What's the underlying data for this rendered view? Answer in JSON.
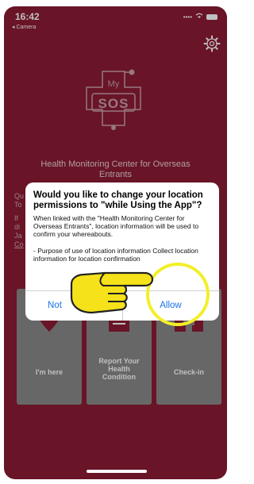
{
  "status_bar": {
    "time": "16:42",
    "back_app": "◂ Camera",
    "signal": "....",
    "wifi": "wifi"
  },
  "logo": {
    "small": "My",
    "large": "SOS"
  },
  "headline": "Health Monitoring Center for Overseas Entrants",
  "background_text": {
    "line_a1": "Qu",
    "line_a2": "To",
    "line_b1": "If",
    "line_b2": "di",
    "line_b3": "Ja",
    "line_b4": "Co"
  },
  "tiles": [
    {
      "label": "I'm here"
    },
    {
      "label": "Report Your Health Condition"
    },
    {
      "label": "Check-in"
    }
  ],
  "dialog": {
    "title": "Would you like to change your location permissions to \"while Using the App\"?",
    "message": "When linked with the \"Health Monitoring Center for Overseas Entrants\", location information will be used to confirm your whereabouts.",
    "purpose": "- Purpose of use of location information Collect location information for location confirmation",
    "left_button": "Not",
    "right_button": "Allow"
  },
  "colors": {
    "background": "#8d1c35",
    "dialog_button": "#1a73e8",
    "highlight": "#f2ef2a",
    "tile": "#8a8a8a"
  },
  "icons": {
    "gear": "gear-icon",
    "hand": "pointing-hand-icon",
    "pin": "location-pin-icon",
    "document": "document-icon",
    "building": "building-icon"
  }
}
